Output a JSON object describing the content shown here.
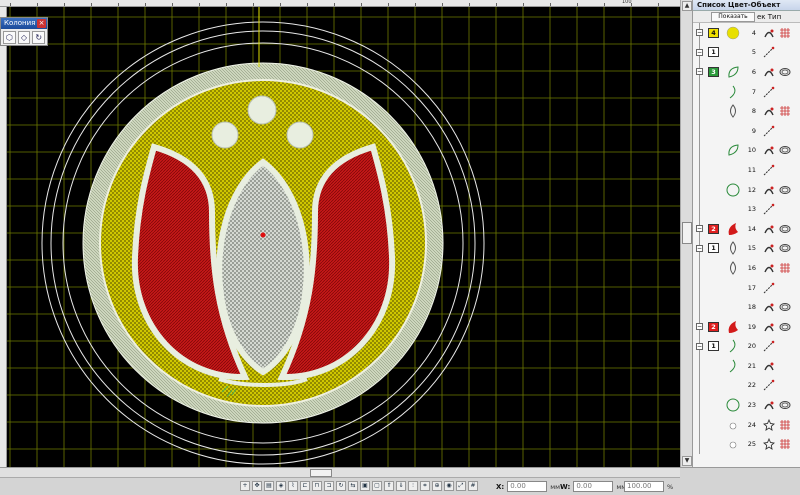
{
  "toolbox": {
    "title": "Колония",
    "tools": [
      "pointer-tool",
      "shape-tool",
      "rotate-tool"
    ]
  },
  "panel": {
    "title": "Список Цвет-Объект",
    "show_button": "Показать",
    "header_text": "ек Тип",
    "rows": [
      {
        "group": "4",
        "group_color": "#f0e000",
        "num": "4",
        "thumb": "circle-fill-icon",
        "i1": "satin-icon",
        "i2": "fill-icon"
      },
      {
        "group": "1",
        "group_color": "#ffffff",
        "num": "5",
        "thumb": "",
        "i1": "run-stitch-icon",
        "i2": ""
      },
      {
        "group": "3",
        "group_color": "#2c9c3c",
        "num": "6",
        "thumb": "leaf-icon",
        "i1": "satin-icon",
        "i2": "applique-icon"
      },
      {
        "group": "",
        "group_color": "",
        "num": "7",
        "thumb": "curve-icon",
        "i1": "run-stitch-icon",
        "i2": ""
      },
      {
        "group": "",
        "group_color": "",
        "num": "8",
        "thumb": "petal-outline-icon",
        "i1": "satin-icon",
        "i2": "fill-icon"
      },
      {
        "group": "",
        "group_color": "",
        "num": "9",
        "thumb": "",
        "i1": "run-stitch-icon",
        "i2": ""
      },
      {
        "group": "",
        "group_color": "",
        "num": "10",
        "thumb": "leaf-icon",
        "i1": "satin-icon",
        "i2": "applique-icon"
      },
      {
        "group": "",
        "group_color": "",
        "num": "11",
        "thumb": "",
        "i1": "run-stitch-icon",
        "i2": ""
      },
      {
        "group": "",
        "group_color": "",
        "num": "12",
        "thumb": "ring-icon",
        "i1": "satin-icon",
        "i2": "applique-icon"
      },
      {
        "group": "",
        "group_color": "",
        "num": "13",
        "thumb": "",
        "i1": "run-stitch-icon",
        "i2": ""
      },
      {
        "group": "2",
        "group_color": "#e02020",
        "num": "14",
        "thumb": "red-petal-icon",
        "i1": "satin-icon",
        "i2": "applique-icon"
      },
      {
        "group": "1",
        "group_color": "#ffffff",
        "num": "15",
        "thumb": "petal-outline-icon",
        "i1": "satin-icon",
        "i2": "applique-icon"
      },
      {
        "group": "",
        "group_color": "",
        "num": "16",
        "thumb": "petal-outline-icon",
        "i1": "satin-icon",
        "i2": "fill-icon"
      },
      {
        "group": "",
        "group_color": "",
        "num": "17",
        "thumb": "",
        "i1": "run-stitch-icon",
        "i2": ""
      },
      {
        "group": "",
        "group_color": "",
        "num": "18",
        "thumb": "",
        "i1": "satin-icon",
        "i2": "applique-icon"
      },
      {
        "group": "2",
        "group_color": "#e02020",
        "num": "19",
        "thumb": "red-petal-icon",
        "i1": "satin-icon",
        "i2": "applique-icon"
      },
      {
        "group": "1",
        "group_color": "#ffffff",
        "num": "20",
        "thumb": "curve-icon",
        "i1": "run-stitch-icon",
        "i2": ""
      },
      {
        "group": "",
        "group_color": "",
        "num": "21",
        "thumb": "curve-icon",
        "i1": "satin-icon",
        "i2": ""
      },
      {
        "group": "",
        "group_color": "",
        "num": "22",
        "thumb": "",
        "i1": "run-stitch-icon",
        "i2": ""
      },
      {
        "group": "",
        "group_color": "",
        "num": "23",
        "thumb": "ring-icon",
        "i1": "satin-icon",
        "i2": "applique-icon"
      },
      {
        "group": "",
        "group_color": "",
        "num": "24",
        "thumb": "dot-icon",
        "i1": "star-icon",
        "i2": "fill-icon"
      },
      {
        "group": "",
        "group_color": "",
        "num": "25",
        "thumb": "dot-icon",
        "i1": "star-icon",
        "i2": "fill-icon"
      }
    ]
  },
  "ruler": {
    "labels": [
      "100"
    ]
  },
  "status": {
    "x_label": "X:",
    "x_value": "0.00",
    "x_unit": "мм",
    "w_label": "W:",
    "w_value": "0.00",
    "w_unit": "мм",
    "pct_value": "100.00",
    "pct_unit": "%"
  },
  "colors": {
    "canvas_bg": "#000000",
    "grid": "#6e7a00",
    "yellow": "#e8e000",
    "red": "#c81414",
    "white_stitch": "#d8e0c8"
  }
}
